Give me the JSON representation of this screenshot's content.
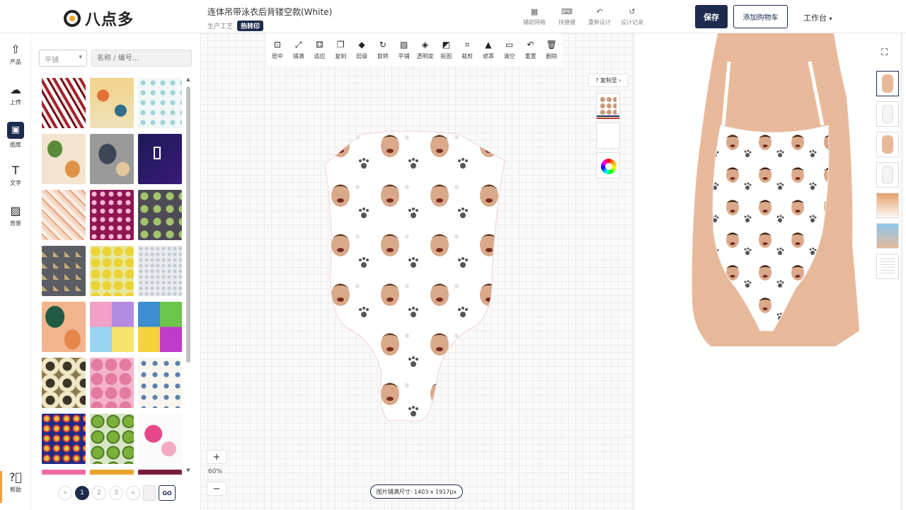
{
  "app": {
    "logo_text": "八点多"
  },
  "header": {
    "doc_title": "连体吊带泳衣后背镂空款(White)",
    "craft_label": "生产工艺",
    "craft_badge": "热转印",
    "tools": [
      {
        "icon": "grid-icon",
        "label": "辅助网格"
      },
      {
        "icon": "keyboard-icon",
        "label": "快捷键"
      },
      {
        "icon": "redesign-icon",
        "label": "重新设计"
      },
      {
        "icon": "history-icon",
        "label": "设计记录"
      }
    ],
    "save_label": "保存",
    "cart_label": "添加购物车",
    "workbench_label": "工作台"
  },
  "rail": {
    "items": [
      {
        "icon": "arrow-up-icon",
        "label": "产品"
      },
      {
        "icon": "cloud-upload-icon",
        "label": "上传"
      },
      {
        "icon": "image-library-icon",
        "label": "图库"
      },
      {
        "icon": "text-icon",
        "label": "文字"
      },
      {
        "icon": "background-icon",
        "label": "背景"
      }
    ],
    "help_label": "帮助"
  },
  "library": {
    "select_value": "平铺",
    "search_placeholder": "名称 / 编号...",
    "pages": [
      "1",
      "2",
      "3"
    ],
    "prev": "«",
    "next": "»",
    "go_label": "GO"
  },
  "canvas": {
    "tools": [
      {
        "icon": "center-icon",
        "label": "居中"
      },
      {
        "icon": "fill-icon",
        "label": "铺满"
      },
      {
        "icon": "fit-icon",
        "label": "适应"
      },
      {
        "icon": "copy-icon",
        "label": "复制"
      },
      {
        "icon": "layers-icon",
        "label": "层级"
      },
      {
        "icon": "rotate-icon",
        "label": "旋转"
      },
      {
        "icon": "tile-icon",
        "label": "平铺"
      },
      {
        "icon": "opacity-icon",
        "label": "透明度"
      },
      {
        "icon": "cutout-icon",
        "label": "抠图"
      },
      {
        "icon": "crop-icon",
        "label": "裁剪"
      },
      {
        "icon": "mask-icon",
        "label": "遮罩"
      },
      {
        "icon": "clear-icon",
        "label": "清空"
      },
      {
        "icon": "reset-icon",
        "label": "重置"
      },
      {
        "icon": "delete-icon",
        "label": "删除"
      }
    ],
    "copy_to_label": "复制至",
    "zoom_in": "+",
    "zoom_out": "−",
    "zoom_level": "60%",
    "image_size_label": "图片铺满尺寸: 1403 x 1917px"
  },
  "colors": {
    "brand": "#1d2b4f",
    "accent": "#f5a623"
  }
}
